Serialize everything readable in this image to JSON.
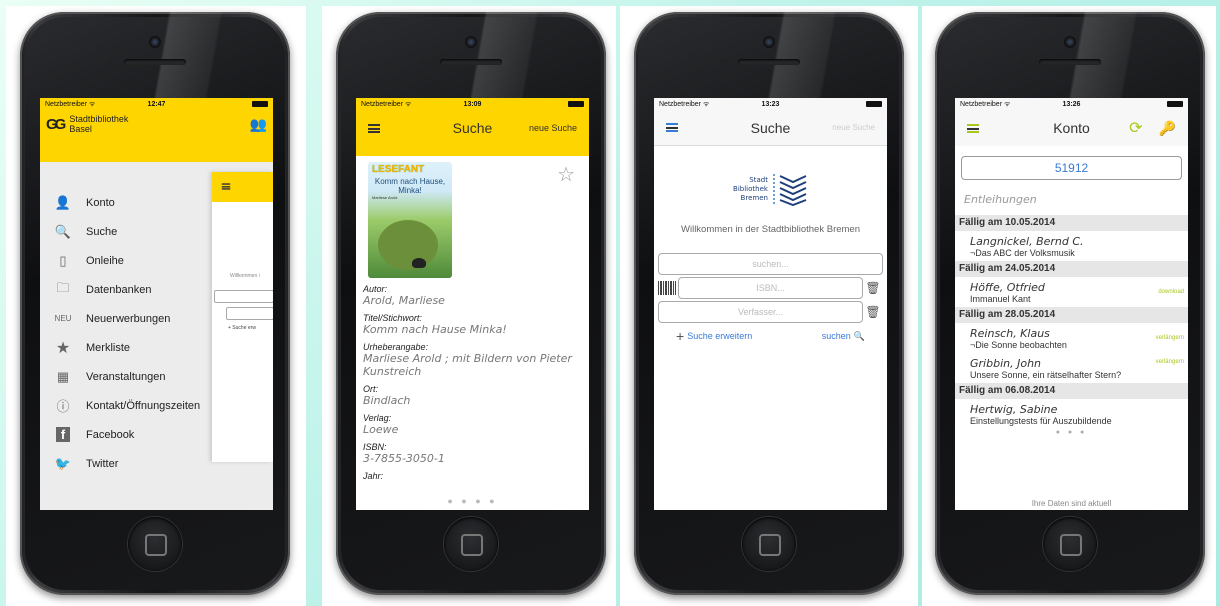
{
  "colors": {
    "accent": "#ffd500",
    "green": "#a5c91f",
    "blue": "#3a7bd5"
  },
  "status": {
    "carrier": "Netzbetreiber ᯤ",
    "times": [
      "12:47",
      "13:09",
      "13:23",
      "13:26"
    ]
  },
  "screen1": {
    "logo_mark": "GG",
    "logo_line1": "Stadtbibliothek",
    "logo_line2": "Basel",
    "behind_welcome": "Willkommen i",
    "behind_more": "+ Suche erw",
    "menu": [
      {
        "icon": "person-icon",
        "glyph": "👤",
        "label": "Konto"
      },
      {
        "icon": "search-icon",
        "glyph": "🔍",
        "label": "Suche"
      },
      {
        "icon": "tablet-icon",
        "glyph": "▯",
        "label": "Onleihe"
      },
      {
        "icon": "folder-icon",
        "glyph": "🗀",
        "label": "Datenbanken"
      },
      {
        "icon": "new-icon",
        "glyph": "NEU",
        "label": "Neuerwerbungen"
      },
      {
        "icon": "star-icon",
        "glyph": "★",
        "label": "Merkliste"
      },
      {
        "icon": "calendar-icon",
        "glyph": "▦",
        "label": "Veranstaltungen"
      },
      {
        "icon": "info-icon",
        "glyph": "ⓘ",
        "label": "Kontakt/Öffnungszeiten"
      },
      {
        "icon": "facebook-icon",
        "glyph": "f",
        "label": "Facebook"
      },
      {
        "icon": "twitter-icon",
        "glyph": "🐦",
        "label": "Twitter"
      }
    ]
  },
  "screen2": {
    "title": "Suche",
    "new_search": "neue Suche",
    "cover": {
      "series": "LESEFANT",
      "title": "Komm nach Hause, Minka!",
      "author": "Marliese Arold"
    },
    "fields": [
      {
        "label": "Autor:",
        "value": "Arold, Marliese"
      },
      {
        "label": "Titel/Stichwort:",
        "value": "Komm nach Hause Minka!"
      },
      {
        "label": "Urheberangabe:",
        "value": "Marliese Arold ; mit Bildern von Pieter Kunstreich"
      },
      {
        "label": "Ort:",
        "value": "Bindlach"
      },
      {
        "label": "Verlag:",
        "value": "Loewe"
      },
      {
        "label": "ISBN:",
        "value": "3-7855-3050-1"
      },
      {
        "label": "Jahr:",
        "value": ""
      }
    ],
    "page_dots": "● ● ● ●"
  },
  "screen3": {
    "title": "Suche",
    "new_search": "neue Suche",
    "logo_lines": [
      "Stadt",
      "Bibliothek",
      "Bremen"
    ],
    "welcome": "Willkommen in der Stadtbibliothek Bremen",
    "search_placeholder": "suchen...",
    "isbn_placeholder": "ISBN...",
    "author_placeholder": "Verfasser...",
    "more_search": "Suche erweitern",
    "search_button": "suchen"
  },
  "screen4": {
    "title": "Konto",
    "account_number": "51912",
    "loans_heading": "Entleihungen",
    "sections": [
      {
        "due": "Fällig am 10.05.2014",
        "items": [
          {
            "who": "Langnickel, Bernd C.",
            "what": "¬Das ABC der Volksmusik",
            "action": ""
          }
        ]
      },
      {
        "due": "Fällig am 24.05.2014",
        "items": [
          {
            "who": "Höffe, Otfried",
            "what": "Immanuel Kant",
            "action": "download"
          }
        ]
      },
      {
        "due": "Fällig am 28.05.2014",
        "items": [
          {
            "who": "Reinsch, Klaus",
            "what": "¬Die Sonne beobachten",
            "action": "verlängern"
          },
          {
            "who": "Gribbin, John",
            "what": "Unsere Sonne, ein rätselhafter Stern?",
            "action": "verlängern"
          }
        ]
      },
      {
        "due": "Fällig am 06.08.2014",
        "items": [
          {
            "who": "Hertwig, Sabine",
            "what": "Einstellungstests für Auszubildende",
            "action": ""
          }
        ]
      }
    ],
    "page_dots": "● ● ●",
    "footer": "Ihre Daten sind aktuell"
  }
}
